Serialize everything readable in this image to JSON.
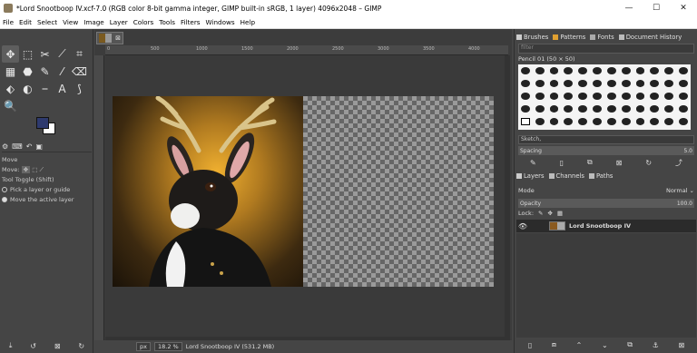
{
  "window": {
    "title": "*Lord Snootboop IV.xcf-7.0 (RGB color 8-bit gamma integer, GIMP built-in sRGB, 1 layer) 4096x2048 – GIMP",
    "minimize": "—",
    "maximize": "☐",
    "close": "✕"
  },
  "menu": [
    "File",
    "Edit",
    "Select",
    "View",
    "Image",
    "Layer",
    "Colors",
    "Tools",
    "Filters",
    "Windows",
    "Help"
  ],
  "toolbox": {
    "tools": [
      "✥",
      "⬚",
      "✂",
      "⟋",
      "⌗",
      "▦",
      "⬣",
      "✎",
      "⁄",
      "⌫",
      "⬖",
      "◐",
      "⎯",
      "A",
      "⟆",
      "🔍"
    ],
    "fg_color": "#2e3a6e",
    "bg_color": "#ffffff",
    "options_title": "Move",
    "move_label": "Move:",
    "toggle_label": "Tool Toggle  (Shift)",
    "opt1": "Pick a layer or guide",
    "opt2": "Move the active layer"
  },
  "canvas": {
    "ruler_marks": [
      "0",
      "500",
      "1000",
      "1500",
      "2000",
      "2500",
      "3000",
      "3500",
      "4000"
    ],
    "status_unit": "px",
    "status_zoom": "18.2 %",
    "status_text": "Lord Snootboop IV (531.2 MB)"
  },
  "dock": {
    "tabs_top": [
      "Brushes",
      "Patterns",
      "Fonts",
      "Document History"
    ],
    "filter_placeholder": "filter",
    "brush_name": "Pencil 01 (50 × 50)",
    "tag": "Sketch,",
    "spacing_label": "Spacing",
    "spacing_value": "5.0",
    "tabs_mid": [
      "Layers",
      "Channels",
      "Paths"
    ],
    "mode_label": "Mode",
    "mode_value": "Normal ⌄",
    "opacity_label": "Opacity",
    "opacity_value": "100.0",
    "lock_label": "Lock:",
    "layer_name": "Lord Snootboop IV"
  }
}
